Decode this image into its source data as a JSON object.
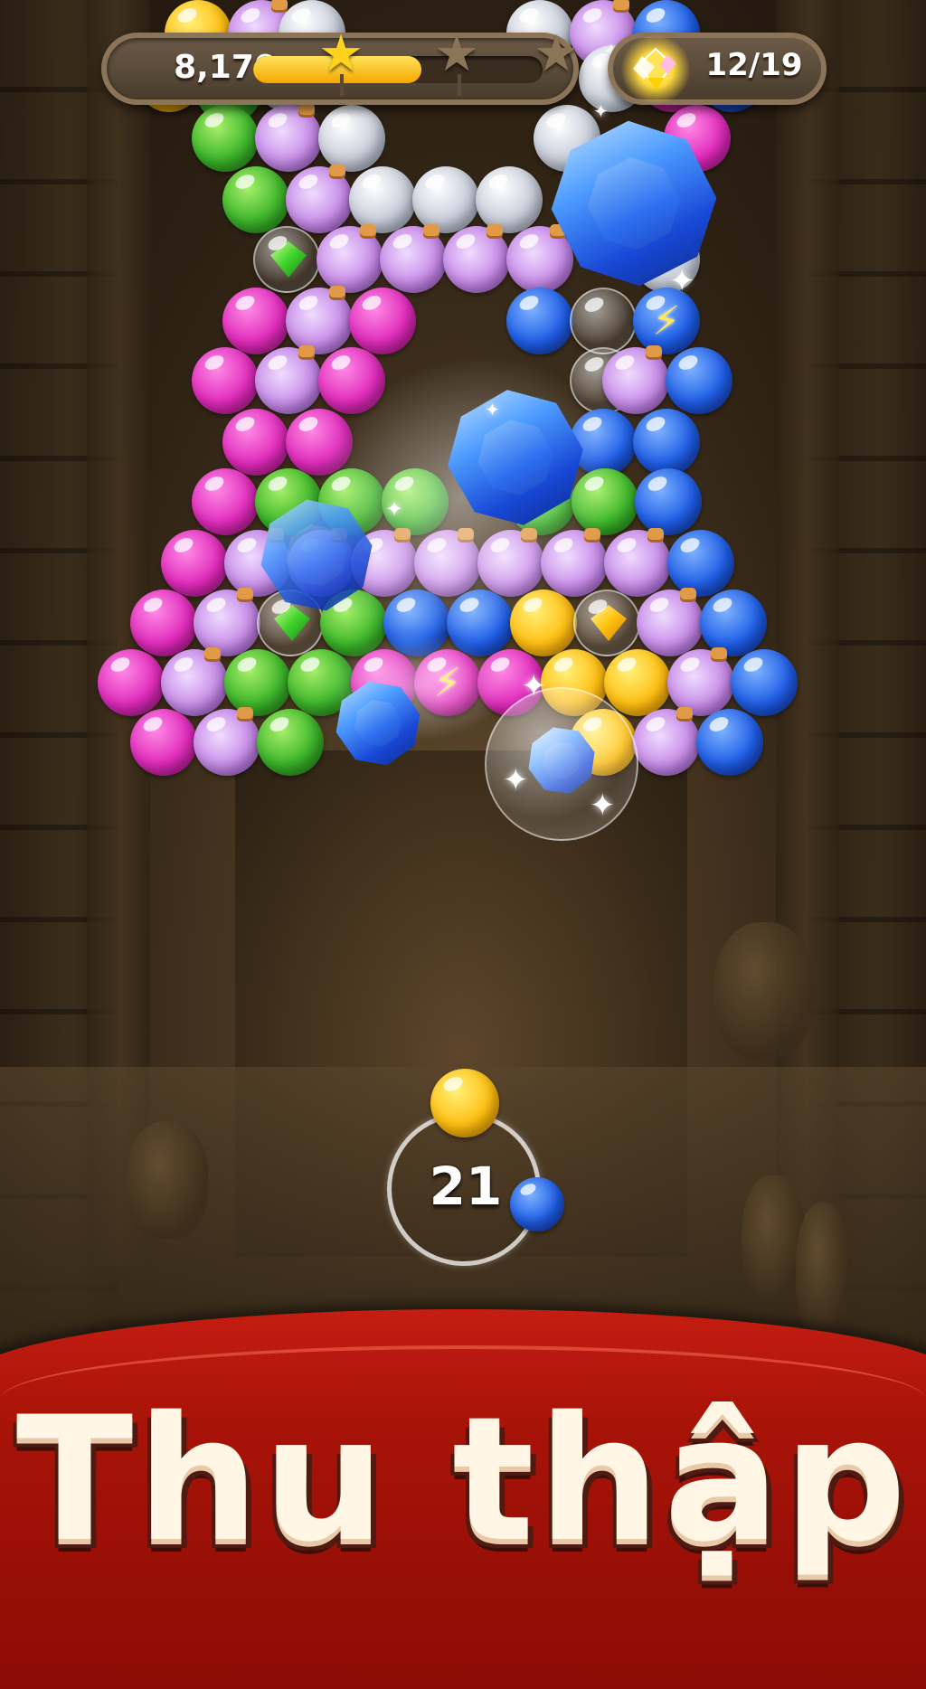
{
  "hud": {
    "score": "8,170",
    "progress_fraction": 0.58,
    "stars": [
      {
        "state": "earned",
        "color": "#ffd21c"
      },
      {
        "state": "locked",
        "color": "#8a7556"
      },
      {
        "state": "locked",
        "color": "#8a7556"
      }
    ],
    "gem_icon": "gem-pile-icon",
    "gem_counter": "12/19"
  },
  "board": {
    "bubble_colors": [
      "green",
      "magenta",
      "blue",
      "yellow",
      "silver",
      "potion",
      "clear"
    ],
    "special_bubbles": [
      "lightning-bubble",
      "gem-bubble-green",
      "gem-bubble-yellow"
    ]
  },
  "shooter": {
    "shots_left": "21",
    "current_ball_color": "yellow",
    "next_ball_color": "blue"
  },
  "banner": {
    "title": "Thu thập"
  },
  "colors": {
    "banner_red": "#b5160b",
    "title_cream": "#fff6e6",
    "progress_gold": "#ffbf12"
  }
}
